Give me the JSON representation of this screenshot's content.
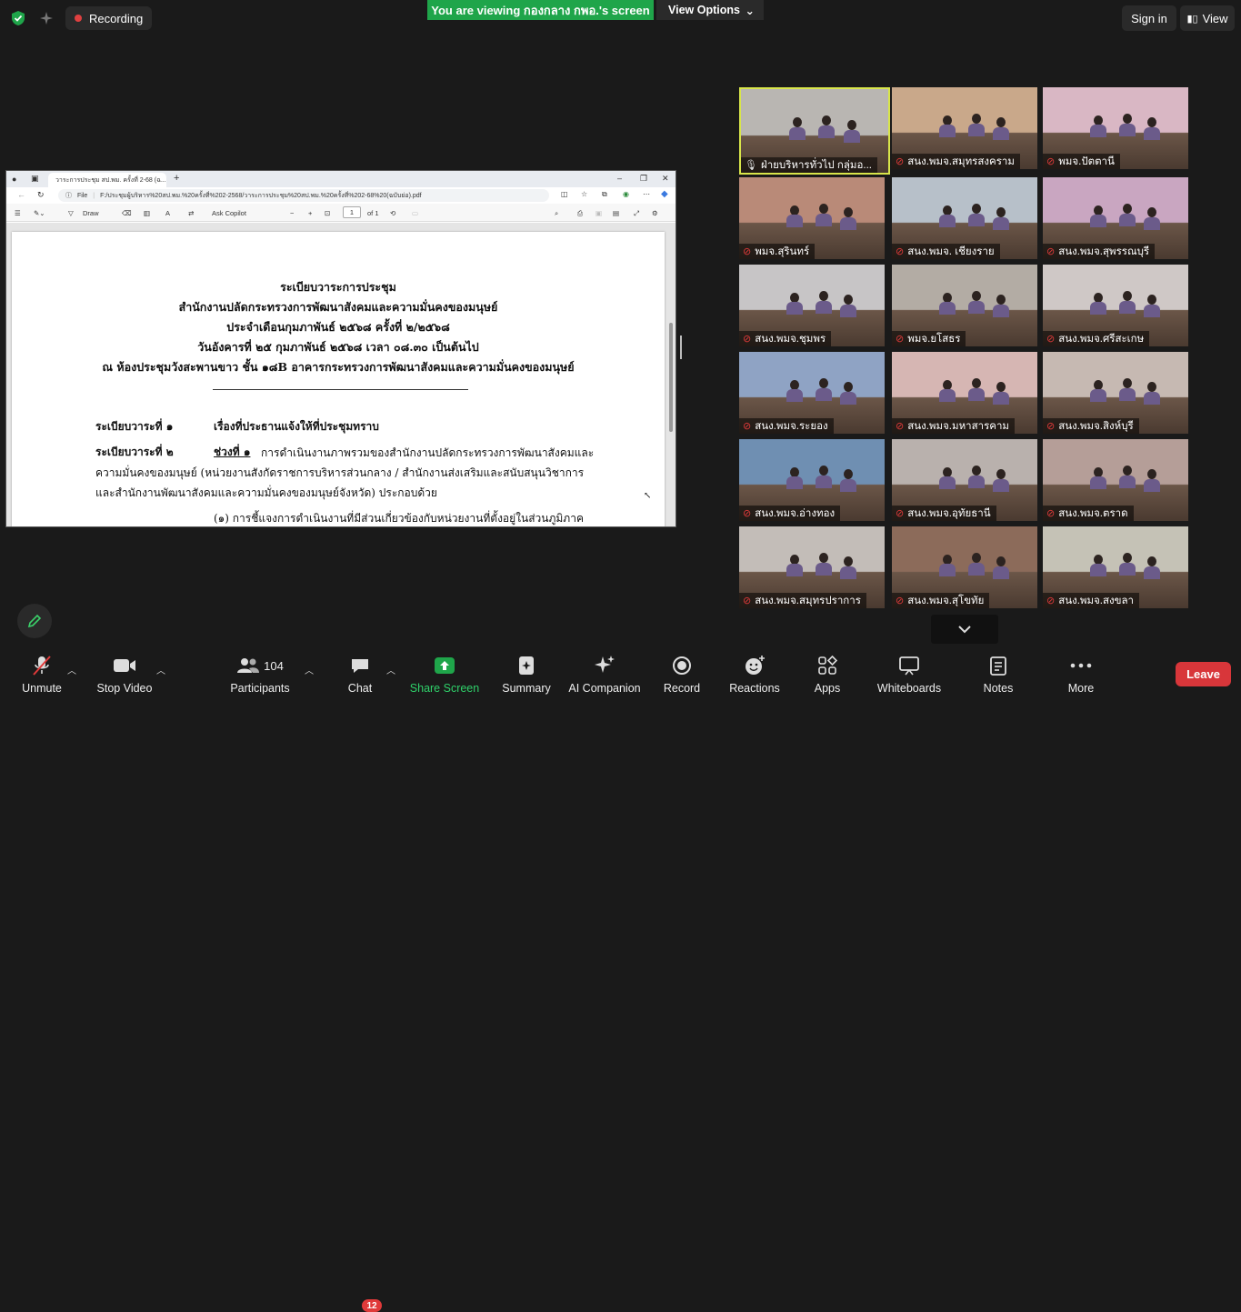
{
  "topbar": {
    "recording_label": "Recording",
    "viewing_text": "You are viewing กองกลาง กพอ.'s screen",
    "view_options_label": "View Options",
    "sign_in_label": "Sign in",
    "view_label": "View"
  },
  "browser": {
    "tab_title": "วาระการประชุม สป.พม. ครั้งที่ 2-68 (ฉ...",
    "url_prefix": "File",
    "url": "F:/ประชุมผู้บริหาร%20สป.พม.%20ครั้งที่%202-2568/วาระการประชุม%20สป.พม.%20ครั้งที่%202-68%20(ฉบับย่อ).pdf",
    "draw_label": "Draw",
    "ask_copilot_label": "Ask Copilot",
    "page_number": "1",
    "page_total": "of 1"
  },
  "document": {
    "heading_lines": [
      "ระเบียบวาระการประชุม",
      "สำนักงานปลัดกระทรวงการพัฒนาสังคมและความมั่นคงของมนุษย์",
      "ประจำเดือนกุมภาพันธ์ ๒๕๖๘ ครั้งที่ ๒/๒๕๖๘",
      "วันอังคารที่ ๒๕ กุมภาพันธ์ ๒๕๖๘ เวลา ๐๘.๓๐ เป็นต้นไป",
      "ณ ห้องประชุมวังสะพานขาว ชั้น ๑๘B อาคารกระทรวงการพัฒนาสังคมและความมั่นคงของมนุษย์"
    ],
    "agenda1_label": "ระเบียบวาระที่ ๑",
    "agenda1_text": "เรื่องที่ประธานแจ้งให้ที่ประชุมทราบ",
    "agenda2_label": "ระเบียบวาระที่ ๒",
    "agenda2_part": "ช่วงที่ ๑",
    "agenda2_line1": "การดำเนินงานภาพรวมของสำนักงานปลัดกระทรวงการพัฒนาสังคมและ",
    "agenda2_line2": "ความมั่นคงของมนุษย์ (หน่วยงานสังกัดราชการบริหารส่วนกลาง / สำนักงานส่งเสริมและสนับสนุนวิชาการ",
    "agenda2_line3": "และสำนักงานพัฒนาสังคมและความมั่นคงของมนุษย์จังหวัด) ประกอบด้วย",
    "item1": "(๑) การชี้แจงการดำเนินงานที่มีส่วนเกี่ยวข้องกับหน่วยงานที่ตั้งอยู่ในส่วนภูมิภาค"
  },
  "participants_tiles": [
    {
      "name": "ฝ่ายบริหารทั่วไป กลุ่มอ...",
      "bg": "#b9b6b2",
      "active": true
    },
    {
      "name": "สนง.พมจ.สมุทรสงคราม",
      "bg": "#c9a88a"
    },
    {
      "name": "พมจ.ปัตตานี",
      "bg": "#d9b7c4"
    },
    {
      "name": "พมจ.สุรินทร์",
      "bg": "#b98a78"
    },
    {
      "name": "สนง.พมจ. เชียงราย",
      "bg": "#b7c0c9"
    },
    {
      "name": "สนง.พมจ.สุพรรณบุรี",
      "bg": "#c9a6c1"
    },
    {
      "name": "สนง.พมจ.ชุมพร",
      "bg": "#c7c5c6"
    },
    {
      "name": "พมจ.ยโสธร",
      "bg": "#b3aca4"
    },
    {
      "name": "สนง.พมจ.ศรีสะเกษ",
      "bg": "#cfc8c6"
    },
    {
      "name": "สนง.พมจ.ระยอง",
      "bg": "#8fa3c4"
    },
    {
      "name": "สนง.พมจ.มหาสารคาม",
      "bg": "#d6b6b3"
    },
    {
      "name": "สนง.พมจ.สิงห์บุรี",
      "bg": "#c6b9b2"
    },
    {
      "name": "สนง.พมจ.อ่างทอง",
      "bg": "#6f8fb2"
    },
    {
      "name": "สนง.พมจ.อุทัยธานี",
      "bg": "#b9b1ad"
    },
    {
      "name": "สนง.พมจ.ตราด",
      "bg": "#b59e98"
    },
    {
      "name": "สนง.พมจ.สมุทรปราการ",
      "bg": "#c3bdb8"
    },
    {
      "name": "สนง.พมจ.สุโขทัย",
      "bg": "#8c6b5a"
    },
    {
      "name": "สนง.พมจ.สงขลา",
      "bg": "#c5c2b6"
    }
  ],
  "toolbar": {
    "unmute_label": "Unmute",
    "stop_video_label": "Stop Video",
    "participants_label": "Participants",
    "participants_count": "104",
    "chat_label": "Chat",
    "chat_badge": "12",
    "share_screen_label": "Share Screen",
    "summary_label": "Summary",
    "ai_companion_label": "AI Companion",
    "record_label": "Record",
    "reactions_label": "Reactions",
    "apps_label": "Apps",
    "whiteboards_label": "Whiteboards",
    "notes_label": "Notes",
    "more_label": "More",
    "leave_label": "Leave"
  },
  "colors": {
    "share_green": "#1fa54a",
    "leave_red": "#d8363a",
    "active_speaker": "#d8e54a"
  }
}
